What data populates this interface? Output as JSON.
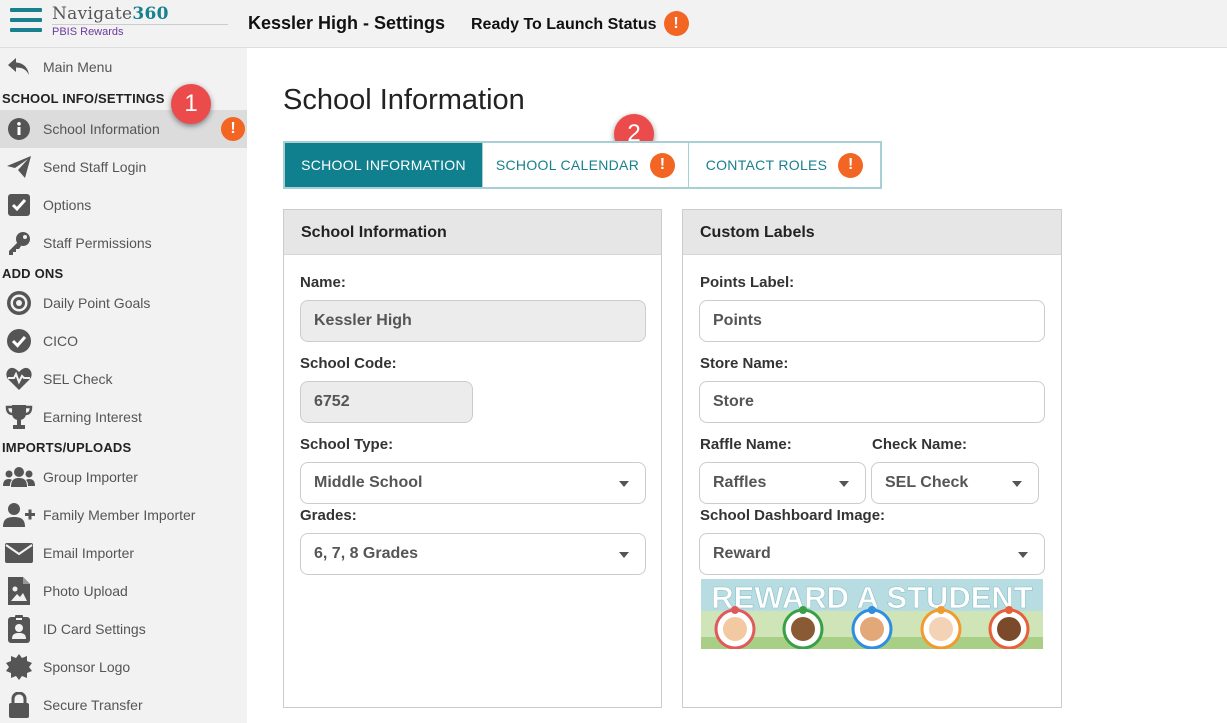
{
  "app": {
    "brand_name": "Navigate",
    "brand_number": "360",
    "brand_sub": "PBIS Rewards",
    "page_heading": "Kessler High - Settings",
    "launch_status": "Ready To Launch Status"
  },
  "sidebar": {
    "main_menu": "Main Menu",
    "sections": {
      "school_info": "SCHOOL INFO/SETTINGS",
      "add_ons": "ADD ONS",
      "imports": "IMPORTS/UPLOADS"
    },
    "items": {
      "school_information": "School Information",
      "send_staff_login": "Send Staff Login",
      "options": "Options",
      "staff_permissions": "Staff Permissions",
      "daily_point_goals": "Daily Point Goals",
      "cico": "CICO",
      "sel_check": "SEL Check",
      "earning_interest": "Earning Interest",
      "group_importer": "Group Importer",
      "family_member_importer": "Family Member Importer",
      "email_importer": "Email Importer",
      "photo_upload": "Photo Upload",
      "id_card_settings": "ID Card Settings",
      "sponsor_logo": "Sponsor Logo",
      "secure_transfer": "Secure Transfer"
    }
  },
  "callouts": {
    "one": "1",
    "two": "2"
  },
  "alert_glyph": "!",
  "main": {
    "title": "School Information",
    "tabs": {
      "school_information": "SCHOOL INFORMATION",
      "school_calendar": "SCHOOL CALENDAR",
      "contact_roles": "CONTACT ROLES"
    }
  },
  "school_panel": {
    "header": "School Information",
    "name_label": "Name:",
    "name_value": "Kessler High",
    "code_label": "School Code:",
    "code_value": "6752",
    "type_label": "School Type:",
    "type_value": "Middle School",
    "grades_label": "Grades:",
    "grades_value": "6, 7, 8 Grades"
  },
  "labels_panel": {
    "header": "Custom Labels",
    "points_label": "Points Label:",
    "points_value": "Points",
    "store_label": "Store Name:",
    "store_value": "Store",
    "raffle_label": "Raffle Name:",
    "raffle_value": "Raffles",
    "check_label": "Check Name:",
    "check_value": "SEL Check",
    "dashboard_label": "School Dashboard Image:",
    "dashboard_value": "Reward",
    "banner_text": "REWARD A STUDENT"
  },
  "colors": {
    "teal": "#10808e",
    "alert": "#f26522",
    "callout": "#ec4b4b",
    "brand_purple": "#6a3aa0"
  }
}
